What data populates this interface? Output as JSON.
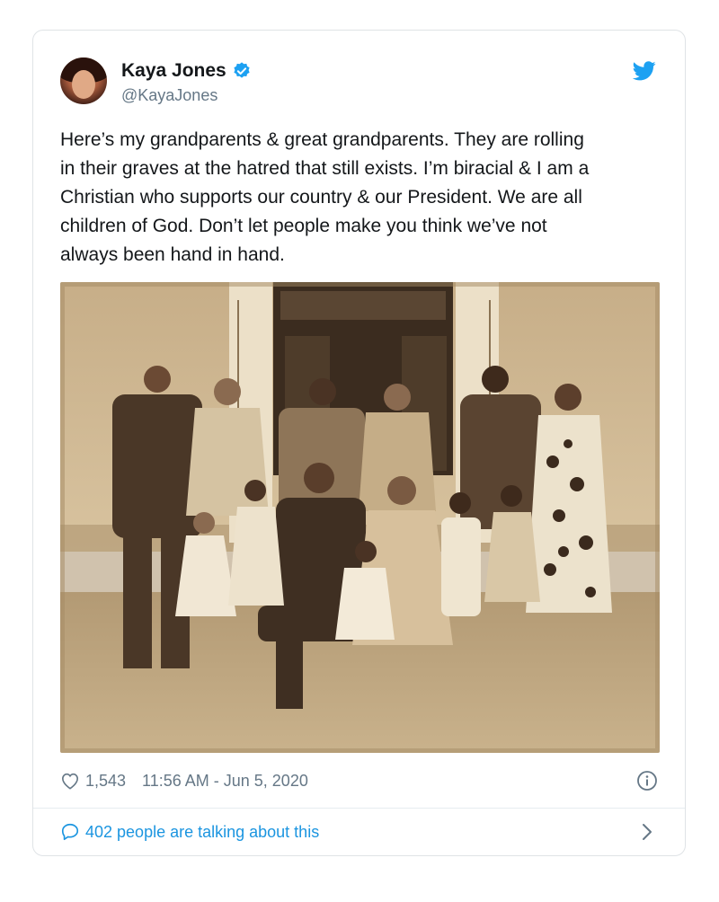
{
  "author": {
    "name": "Kaya Jones",
    "handle": "@KayaJones",
    "verified": true
  },
  "tweet": {
    "text": "Here’s my grandparents & great grandparents. They are rolling\nin their graves at the hatred that still exists. I’m biracial & I am a\nChristian who supports our country & our President. We are all\nchildren of God. Don’t let people make you think we’ve not\nalways been hand in hand."
  },
  "stats": {
    "likes": "1,543",
    "timestamp": "11:56 AM - Jun 5, 2020"
  },
  "conversation": {
    "label": "402 people are talking about this"
  },
  "icons": {
    "twitter": "twitter-bird-icon",
    "verified": "verified-badge-icon",
    "like": "heart-icon",
    "info": "info-icon",
    "reply": "speech-bubble-icon",
    "chevron": "chevron-right-icon"
  },
  "colors": {
    "accent": "#1da1f2",
    "link": "#1b95e0",
    "muted": "#657786",
    "text": "#14171a",
    "sepia": "#c9b08a"
  }
}
